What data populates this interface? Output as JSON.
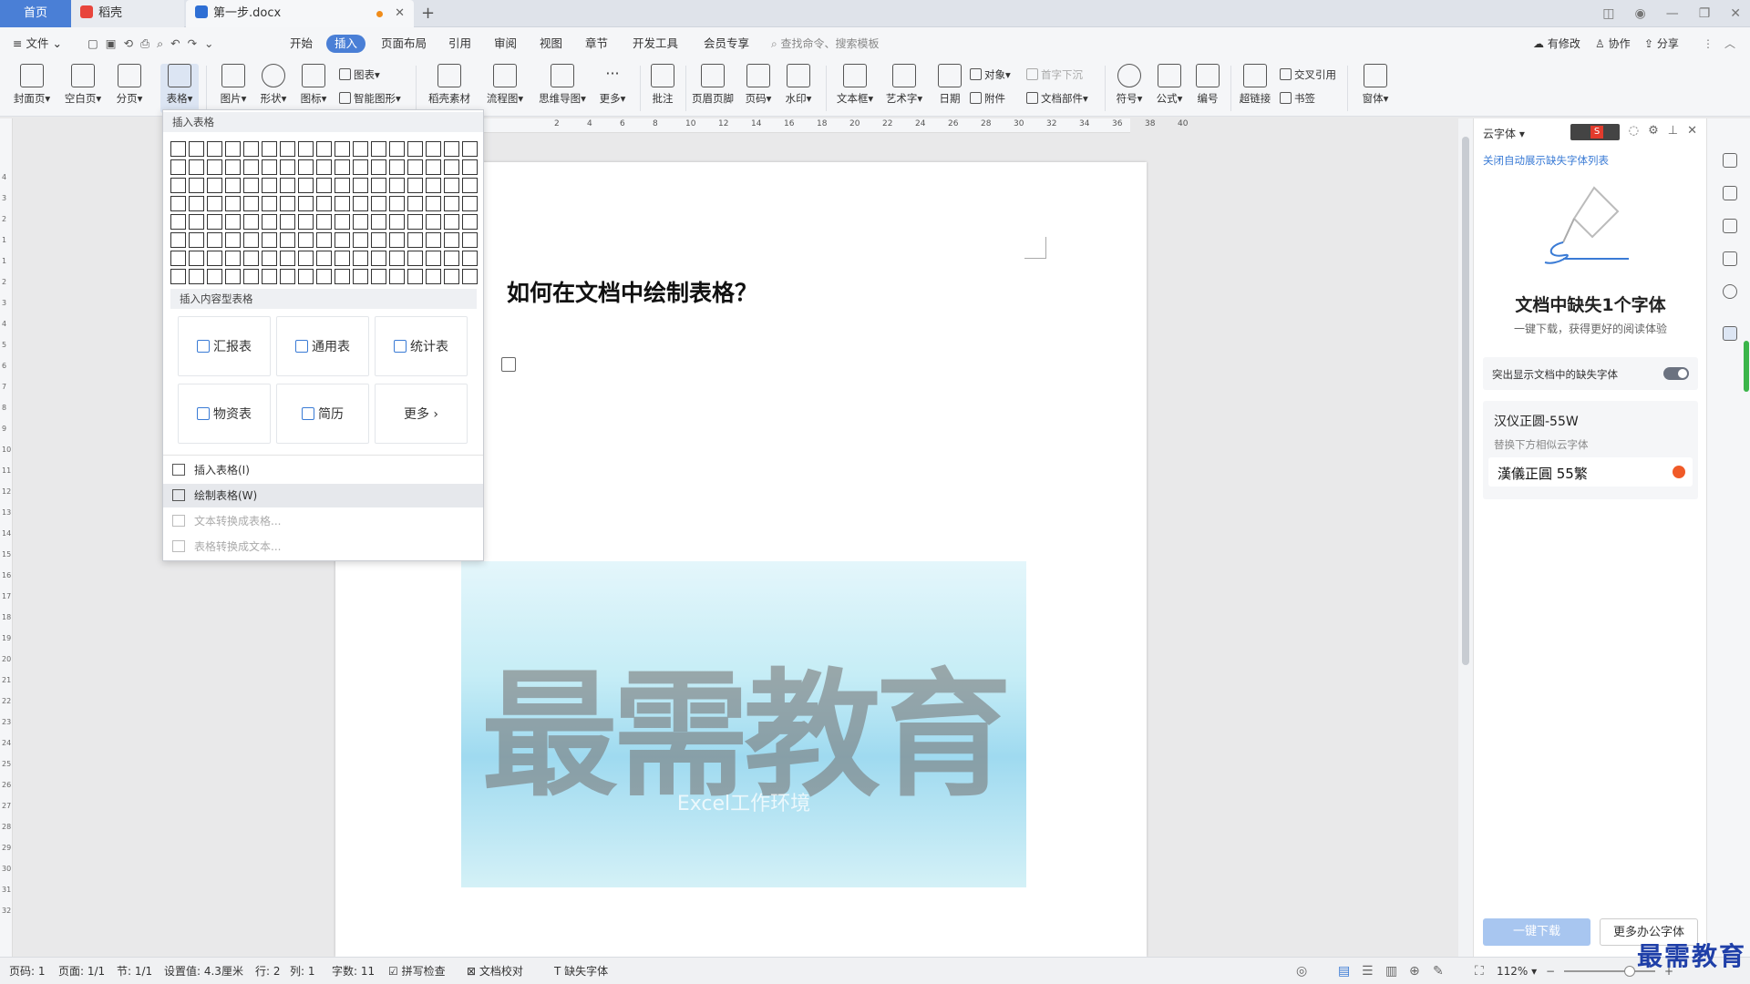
{
  "titlebar": {
    "tab_home": "首页",
    "tab_daoke": "稻壳",
    "tab_doc": "第一步.docx",
    "add": "+"
  },
  "menu": {
    "file": "文件",
    "items": [
      "开始",
      "插入",
      "页面布局",
      "引用",
      "审阅",
      "视图",
      "章节",
      "开发工具",
      "会员专享"
    ],
    "search_placeholder": "查找命令、搜索模板",
    "right": [
      "有修改",
      "协作",
      "分享"
    ]
  },
  "ribbon": {
    "cover": "封面页",
    "blank": "空白页",
    "pagebreak": "分页",
    "table": "表格",
    "picture": "图片",
    "shape": "形状",
    "icon": "图标",
    "chart": "图表",
    "smartart": "智能图形",
    "daoke": "稻壳素材",
    "flowchart": "流程图",
    "mindmap": "思维导图",
    "more": "更多",
    "comment": "批注",
    "headerfooter": "页眉页脚",
    "pagenum": "页码",
    "watermark": "水印",
    "textbox": "文本框",
    "wordart": "艺术字",
    "date": "日期",
    "object": "对象",
    "attachment": "附件",
    "dropcap": "首字下沉",
    "docpart": "文档部件",
    "symbol": "符号",
    "formula": "公式",
    "numbering": "编号",
    "hyperlink": "超链接",
    "crossref": "交叉引用",
    "bookmark": "书签",
    "window": "窗体"
  },
  "dropdown": {
    "insert_table_header": "插入表格",
    "content_table_header": "插入内容型表格",
    "templates": [
      "汇报表",
      "通用表",
      "统计表",
      "物资表",
      "简历",
      "更多"
    ],
    "actions": [
      {
        "label": "插入表格(I)",
        "disabled": false
      },
      {
        "label": "绘制表格(W)",
        "disabled": false
      },
      {
        "label": "文本转换成表格...",
        "disabled": true
      },
      {
        "label": "表格转换成文本...",
        "disabled": true
      }
    ],
    "grid_cols": 17,
    "grid_rows": 8
  },
  "document": {
    "title": "如何在文档中绘制表格？",
    "image_watermark": "最需教育",
    "image_caption": "Excel工作环境"
  },
  "ruler_h": [
    "2",
    "4",
    "6",
    "8",
    "10",
    "12",
    "14",
    "16",
    "18",
    "20",
    "22",
    "24",
    "26",
    "28",
    "30",
    "32",
    "34",
    "36",
    "38",
    "40"
  ],
  "ruler_v": [
    "4",
    "3",
    "2",
    "1",
    "1",
    "2",
    "3",
    "4",
    "5",
    "6",
    "7",
    "8",
    "9",
    "10",
    "11",
    "12",
    "13",
    "14",
    "15",
    "16",
    "17",
    "18",
    "19",
    "20",
    "21",
    "22",
    "23",
    "24",
    "25",
    "26",
    "27",
    "28",
    "29",
    "30",
    "31",
    "32"
  ],
  "panel": {
    "title": "云字体",
    "close_link": "关闭自动展示缺失字体列表",
    "heading": "文档中缺失1个字体",
    "subheading": "一键下载，获得更好的阅读体验",
    "toggle_label": "突出显示文档中的缺失字体",
    "font_name": "汉仪正圆-55W",
    "replace_hint": "替换下方相似云字体",
    "font_sample": "漢儀正圓 55繁",
    "btn_download": "一键下载",
    "btn_more": "更多办公字体"
  },
  "status": {
    "page": "页码: 1",
    "pages": "页面: 1/1",
    "section": "节: 1/1",
    "setting": "设置值: 4.3厘米",
    "row": "行: 2",
    "col": "列: 1",
    "words": "字数: 11",
    "spell": "拼写检查",
    "proof": "文档校对",
    "missing_font": "缺失字体",
    "zoom": "112%"
  },
  "corner_watermark": "最需教育",
  "colors": {
    "accent": "#4a7fd6",
    "home_tab": "#4a7fd6",
    "unsaved_dot": "#f08c1a"
  }
}
